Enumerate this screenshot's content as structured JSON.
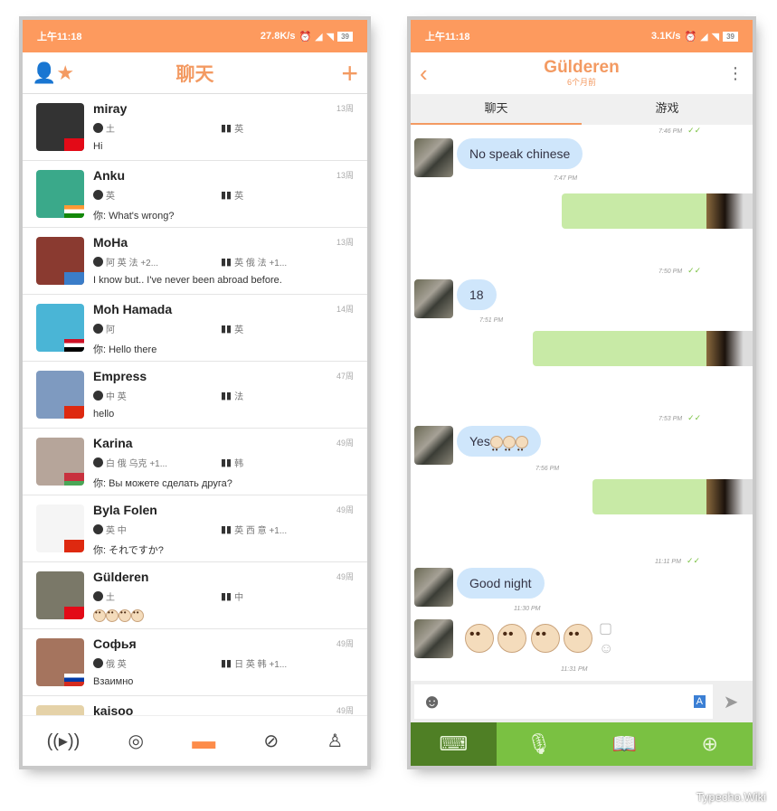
{
  "left": {
    "status": {
      "time": "上午11:18",
      "speed": "27.8K/s",
      "battery": "39"
    },
    "header": {
      "title": "聊天"
    },
    "contacts": [
      {
        "name": "miray",
        "time": "13周",
        "native": "土",
        "learning": "英",
        "preview": "Hi",
        "avatar": "#333",
        "flag": "turkey"
      },
      {
        "name": "Anku",
        "time": "13周",
        "native": "英",
        "learning": "英",
        "preview": "你: What's wrong?",
        "avatar": "#3aa98a",
        "flag": "india"
      },
      {
        "name": "MoHa",
        "time": "13周",
        "native": "阿 英 法 +2...",
        "learning": "英 俄 法 +1...",
        "preview": "I know but.. I've never been abroad before.",
        "avatar": "#8a3a30",
        "flag": "antarctica"
      },
      {
        "name": "Moh Hamada",
        "time": "14周",
        "native": "阿",
        "learning": "英",
        "preview": "你: Hello there",
        "avatar": "#4ab5d6",
        "flag": "egypt"
      },
      {
        "name": "Empress",
        "time": "47周",
        "native": "中 英",
        "learning": "法",
        "preview": "hello",
        "avatar": "#7e9ac0",
        "flag": "china"
      },
      {
        "name": "Karina",
        "time": "49周",
        "native": "白 俄 乌克 +1...",
        "learning": "韩",
        "preview": "你: Вы можете сделать друга?",
        "avatar": "#b6a59a",
        "flag": "belarus"
      },
      {
        "name": "Byla Folen",
        "time": "49周",
        "native": "英 中",
        "learning": "英 西 意 +1...",
        "preview": "你: それですか?",
        "avatar": "#f5f5f5",
        "flag": "china"
      },
      {
        "name": "Gülderen",
        "time": "49周",
        "native": "土",
        "learning": "中",
        "preview": "",
        "avatar": "#7a7868",
        "flag": "turkey"
      },
      {
        "name": "Софья",
        "time": "49周",
        "native": "俄 英",
        "learning": "日 英 韩 +1...",
        "preview": "Взаимно",
        "avatar": "#a5745e",
        "flag": "russia"
      },
      {
        "name": "kaisoo",
        "time": "49周",
        "native": "",
        "learning": "",
        "preview": "",
        "avatar": "#e5d2a8",
        "flag": ""
      }
    ],
    "nav": [
      "live-icon",
      "moments-icon",
      "chat-icon",
      "discover-icon",
      "profile-icon"
    ]
  },
  "right": {
    "status": {
      "time": "上午11:18",
      "speed": "3.1K/s",
      "battery": "39"
    },
    "header": {
      "title": "Gülderen",
      "subtitle": "6个月前"
    },
    "tabs": [
      "聊天",
      "游戏"
    ],
    "messages": {
      "t0": "7:46 PM",
      "m1": "No speak chinese",
      "t1": "7:47 PM",
      "t2": "7:50 PM",
      "m3": "18",
      "t3": "7:51 PM",
      "t4": "7:53 PM",
      "m5": "Yes",
      "t5": "7:56 PM",
      "t6": "11:11 PM",
      "m7": "Good night",
      "t7": "11:30 PM",
      "t8": "11:31 PM"
    }
  },
  "colors": {
    "accent": "#fd9a5e",
    "bubble_in": "#cfe6fb",
    "bubble_out": "#c8eaa6",
    "green_bar": "#7ac142"
  },
  "watermark": "Typecho.Wiki"
}
